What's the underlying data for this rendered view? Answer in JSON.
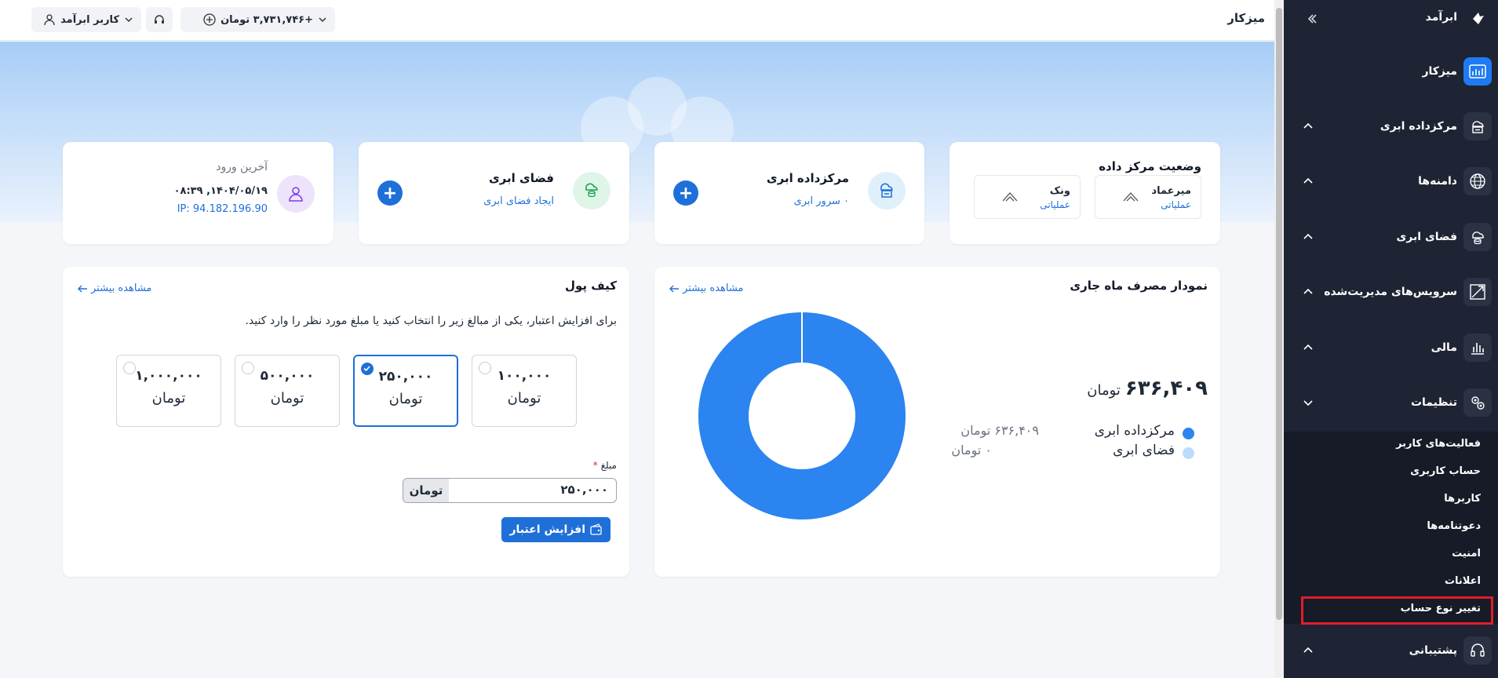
{
  "sidebar": {
    "brand": "ابرآمد",
    "items": [
      {
        "label": "میزکار",
        "icon": "dashboard-chart-icon",
        "active": true
      },
      {
        "label": "مرکزداده ابری",
        "icon": "cloud-server-icon"
      },
      {
        "label": "دامنه‌ها",
        "icon": "globe-icon"
      },
      {
        "label": "فضای ابری",
        "icon": "cloud-storage-icon"
      },
      {
        "label": "سرویس‌های مدیریت‌شده",
        "icon": "managed-services-icon"
      },
      {
        "label": "مالی",
        "icon": "finance-chart-icon"
      },
      {
        "label": "تنظیمات",
        "icon": "settings-gears-icon"
      },
      {
        "label": "پشتیبانی",
        "icon": "headset-icon"
      }
    ],
    "settings_sub": [
      "فعالیت‌های کاربر",
      "حساب کاربری",
      "کاربرها",
      "دعوتنامه‌ها",
      "امنیت",
      "اعلانات",
      "تغییر نوع حساب"
    ]
  },
  "topbar": {
    "title": "میزکار",
    "balance": "+۳,۷۳۱,۷۴۶ تومان",
    "user": "کاربر ابرآمد"
  },
  "datacenter_status": {
    "title": "وضعیت مرکز داده",
    "sites": [
      {
        "name": "میرعماد",
        "status": "عملیاتی"
      },
      {
        "name": "ونک",
        "status": "عملیاتی"
      }
    ]
  },
  "cloud_dc_card": {
    "title": "مرکزداده ابری",
    "subtitle": "۰ سرور ابری"
  },
  "cloud_space_card": {
    "title": "فضای ابری",
    "subtitle": "ایجاد فضای ابری"
  },
  "last_login": {
    "title": "آخرین ورود",
    "datetime": "۱۴۰۴/۰۵/۱۹, ۰۸:۳۹",
    "ip": "IP: 94.182.196.90"
  },
  "usage_chart": {
    "title": "نمودار مصرف ماه جاری",
    "see_more": "مشاهده بیشتر",
    "total_value": "۶۳۶,۴۰۹",
    "total_unit": "تومان"
  },
  "chart_data": {
    "type": "pie",
    "title": "نمودار مصرف ماه جاری",
    "categories": [
      "مرکزداده ابری",
      "فضای ابری"
    ],
    "values": [
      636409,
      0
    ],
    "value_labels": [
      "۶۳۶,۴۰۹ تومان",
      "۰ تومان"
    ],
    "colors": [
      "#2b84f0",
      "#bcdcfb"
    ],
    "donut": true
  },
  "wallet": {
    "title": "کیف پول",
    "see_more": "مشاهده بیشتر",
    "description": "برای افزایش اعتبار، یکی از مبالغ زیر را انتخاب کنید یا مبلغ مورد نظر را وارد کنید.",
    "options": [
      {
        "value": "۱۰۰,۰۰۰",
        "unit": "تومان",
        "selected": false
      },
      {
        "value": "۲۵۰,۰۰۰",
        "unit": "تومان",
        "selected": true
      },
      {
        "value": "۵۰۰,۰۰۰",
        "unit": "تومان",
        "selected": false
      },
      {
        "value": "۱,۰۰۰,۰۰۰",
        "unit": "تومان",
        "selected": false
      }
    ],
    "amount_label": "مبلغ",
    "amount_value": "۲۵۰,۰۰۰",
    "amount_unit": "تومان",
    "submit_label": "افزایش اعتبار"
  }
}
